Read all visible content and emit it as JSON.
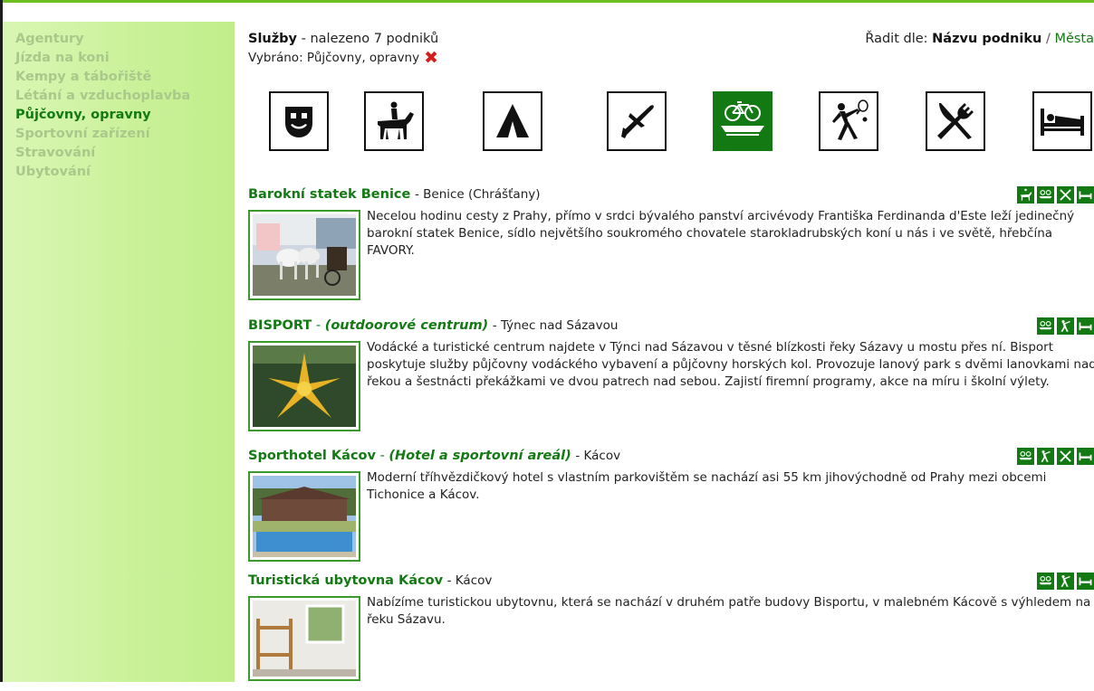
{
  "sidebar": {
    "items": [
      {
        "label": "Agentury",
        "active": false
      },
      {
        "label": "Jízda na koni",
        "active": false
      },
      {
        "label": "Kempy a tábořiště",
        "active": false
      },
      {
        "label": "Létání a vzduchoplavba",
        "active": false
      },
      {
        "label": "Půjčovny, opravny",
        "active": true
      },
      {
        "label": "Sportovní zařízení",
        "active": false
      },
      {
        "label": "Stravování",
        "active": false
      },
      {
        "label": "Ubytování",
        "active": false
      }
    ]
  },
  "header": {
    "title": "Služby",
    "count_text": "- nalezeno 7 podniků",
    "selected_prefix": "Vybráno: Půjčovny, opravny",
    "remove_glyph": "✖",
    "sort_label": "Řadit dle:",
    "sort_active": "Názvu podniku",
    "sort_sep": "/",
    "sort_other": "Města"
  },
  "filters": [
    {
      "icon": "mask-icon",
      "selected": false
    },
    {
      "icon": "horse-rider-icon",
      "selected": false
    },
    {
      "icon": "tent-icon",
      "selected": false
    },
    {
      "icon": "airplane-icon",
      "selected": false
    },
    {
      "icon": "bicycle-canoe-icon",
      "selected": true
    },
    {
      "icon": "tennis-player-icon",
      "selected": false
    },
    {
      "icon": "fork-knife-icon",
      "selected": false
    },
    {
      "icon": "bed-icon",
      "selected": false
    }
  ],
  "listings": [
    {
      "name": "Barokní statek Benice",
      "subtitle": "",
      "location": "- Benice (Chrášťany)",
      "description": "Necelou hodinu cesty z Prahy, přímo v srdci bývalého panství arcivévody Františka Ferdinanda d'Este leží jedinečný barokní statek Benice, sídlo největšího soukromého chovatele starokladrubských koní u nás i ve světě, hřebčína FAVORY.",
      "icons": [
        "horse-rider-icon",
        "bicycle-canoe-icon",
        "fork-knife-icon",
        "bed-icon"
      ],
      "photo": "horses-carriage"
    },
    {
      "name": "BISPORT",
      "subtitle": "(outdoorové centrum)",
      "location": "- Týnec nad Sázavou",
      "description": "Vodácké a turistické centrum najdete v Týnci nad Sázavou v těsné blízkosti řeky Sázavy u mostu přes ní. Bisport poskytuje služby půjčovny vodáckého vybavení a půjčovny horských kol. Provozuje lanový park s dvěmi lanovkami nad řekou a šestnácti překážkami ve dvou patrech nad sebou. Zajistí firemní programy, akce na míru i školní výlety.",
      "icons": [
        "bicycle-canoe-icon",
        "tennis-player-icon",
        "bed-icon"
      ],
      "photo": "canoes-star"
    },
    {
      "name": "Sporthotel Kácov",
      "subtitle": "(Hotel a sportovní areál)",
      "location": "- Kácov",
      "description": "Moderní tříhvězdičkový hotel s vlastním parkovištěm se nachází asi 55 km jihovýchodně od Prahy mezi obcemi Tichonice a Kácov.",
      "icons": [
        "bicycle-canoe-icon",
        "tennis-player-icon",
        "fork-knife-icon",
        "bed-icon"
      ],
      "photo": "hotel-pool"
    },
    {
      "name": "Turistická ubytovna Kácov",
      "subtitle": "",
      "location": "- Kácov",
      "description": "Nabízíme turistickou ubytovnu, která se nachází v druhém patře budovy Bisportu, v malebném Kácově s výhledem na řeku Sázavu.",
      "icons": [
        "bicycle-canoe-icon",
        "tennis-player-icon",
        "bed-icon"
      ],
      "photo": "bunk-room"
    }
  ]
}
